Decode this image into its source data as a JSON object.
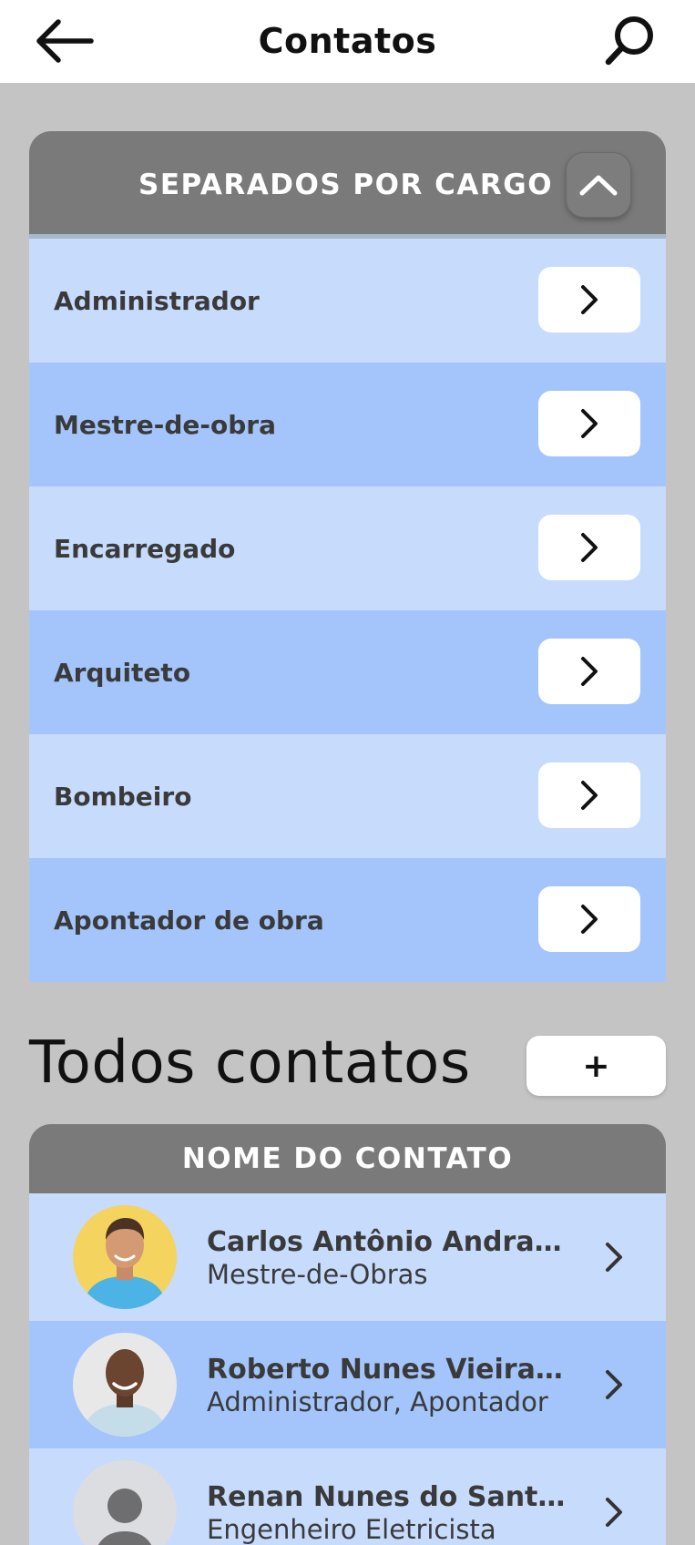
{
  "header": {
    "title": "Contatos",
    "back_icon": "arrow-left-icon",
    "search_icon": "search-icon"
  },
  "categories": {
    "title": "SEPARADOS POR CARGO",
    "collapse_icon": "chevron-up-icon",
    "items": [
      {
        "label": "Administrador"
      },
      {
        "label": "Mestre-de-obra"
      },
      {
        "label": "Encarregado"
      },
      {
        "label": "Arquiteto"
      },
      {
        "label": "Bombeiro"
      },
      {
        "label": "Apontador de obra"
      }
    ]
  },
  "contacts": {
    "section_title": "Todos contatos",
    "add_label": "+",
    "column_header": "NOME DO CONTATO",
    "items": [
      {
        "name": "Carlos Antônio Andrade",
        "role": "Mestre-de-Obras"
      },
      {
        "name": "Roberto Nunes Vieira d...",
        "role": "Administrador, Apontador"
      },
      {
        "name": "Renan Nunes do Santos",
        "role": "Engenheiro Eletricista"
      }
    ]
  },
  "colors": {
    "background": "#c4c4c4",
    "header_gray": "#7a7a7a",
    "row_light": "#c7dbfc",
    "row_dark": "#a3c5fb"
  }
}
